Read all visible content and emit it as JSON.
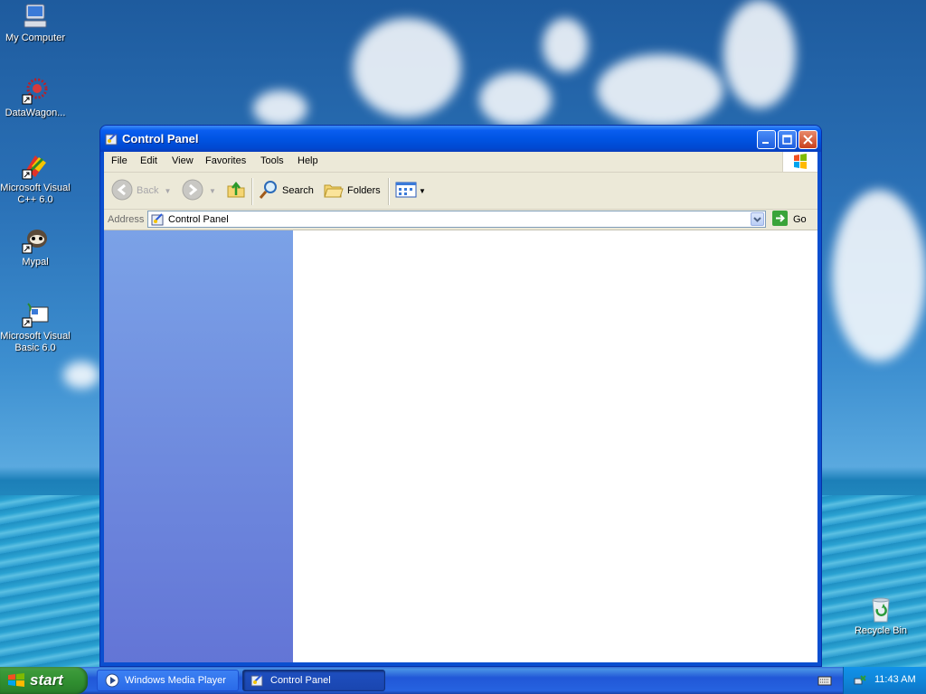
{
  "desktop": {
    "icons": [
      {
        "label": "My Computer",
        "icon": "my-computer-icon"
      },
      {
        "label": "DataWagon...",
        "icon": "datawagon-shortcut-icon"
      },
      {
        "label": "Microsoft Visual C++ 6.0",
        "icon": "visual-cpp-shortcut-icon"
      },
      {
        "label": "Mypal",
        "icon": "mypal-shortcut-icon"
      },
      {
        "label": "Microsoft Visual Basic 6.0",
        "icon": "visual-basic-shortcut-icon"
      },
      {
        "label": "Recycle Bin",
        "icon": "recycle-bin-icon"
      }
    ]
  },
  "window": {
    "title": "Control Panel",
    "menu": [
      "File",
      "Edit",
      "View",
      "Favorites",
      "Tools",
      "Help"
    ],
    "toolbar": {
      "back": "Back",
      "search": "Search",
      "folders": "Folders"
    },
    "address": {
      "label": "Address",
      "value": "Control Panel",
      "go": "Go"
    }
  },
  "taskbar": {
    "start": "start",
    "tasks": [
      {
        "label": "Windows Media Player",
        "active": false
      },
      {
        "label": "Control Panel",
        "active": true
      }
    ],
    "clock": "11:43 AM"
  },
  "colors": {
    "titlebar": "#0054e3",
    "taskpane_top": "#7ba2e7",
    "taskpane_bottom": "#6375d6",
    "start_green": "#2f8d2f"
  }
}
